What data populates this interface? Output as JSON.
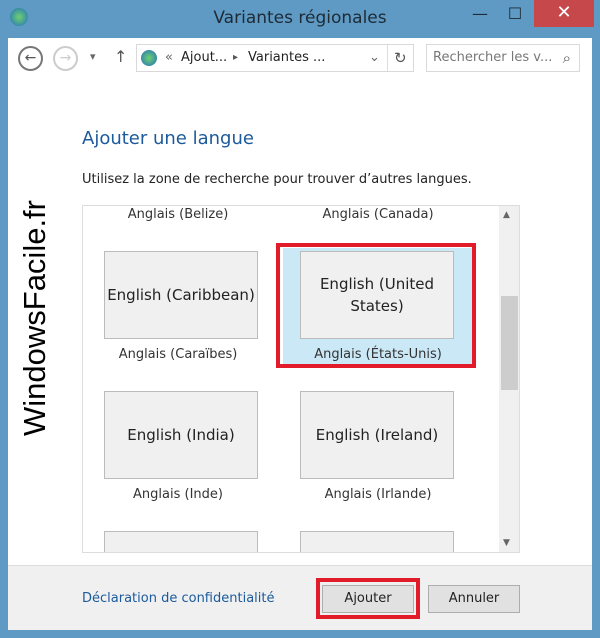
{
  "window": {
    "title": "Variantes régionales",
    "minimize": "—",
    "maximize": "☐",
    "close": "✕"
  },
  "nav": {
    "back": "←",
    "forward": "→",
    "recent": "▾",
    "up": "↑",
    "breadcrumb": [
      "«",
      "Ajout...",
      "▸",
      "Variantes ..."
    ],
    "dropdown": "⌄",
    "refresh": "↻",
    "search_placeholder": "Rechercher les v...",
    "search_icon": "⌕"
  },
  "main": {
    "heading": "Ajouter une langue",
    "description": "Utilisez la zone de recherche pour trouver d’autres langues.",
    "top_labels": [
      "Anglais (Belize)",
      "Anglais (Canada)"
    ],
    "tiles": [
      {
        "name": "English (Caribbean)",
        "label": "Anglais (Caraïbes)",
        "selected": false
      },
      {
        "name": "English (United States)",
        "label": "Anglais (États-Unis)",
        "selected": true
      },
      {
        "name": "English (India)",
        "label": "Anglais (Inde)",
        "selected": false
      },
      {
        "name": "English (Ireland)",
        "label": "Anglais (Irlande)",
        "selected": false
      }
    ],
    "scroll_up": "▲",
    "scroll_down": "▼"
  },
  "footer": {
    "privacy_link": "Déclaration de confidentialité",
    "add": "Ajouter",
    "cancel": "Annuler"
  },
  "watermark": "WindowsFacile.fr",
  "colors": {
    "frame": "#5f9ac4",
    "highlight": "#e21b2a",
    "selected": "#cbe8f6",
    "link": "#1c5a9c"
  }
}
